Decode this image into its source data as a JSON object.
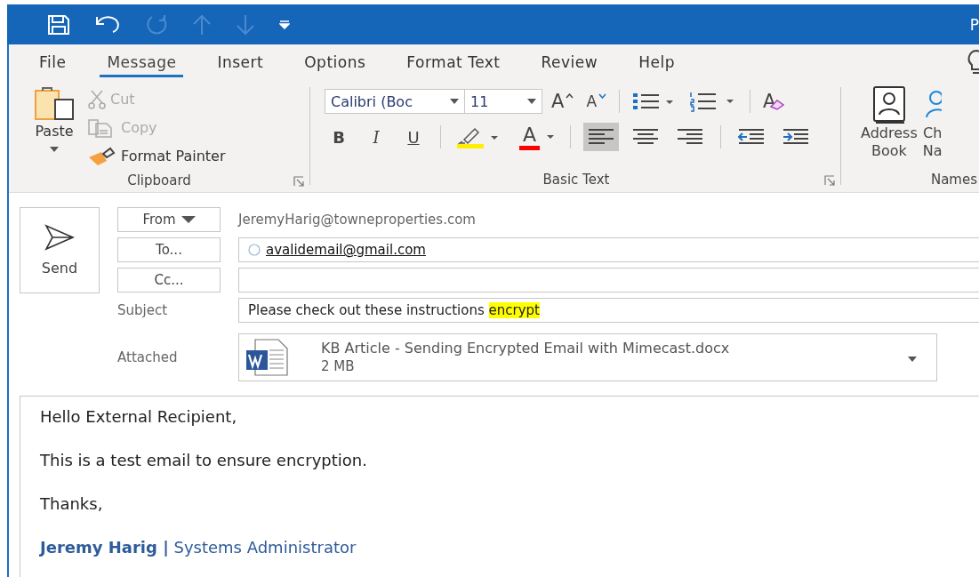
{
  "title_bar": {
    "title": "P",
    "quick_access": [
      {
        "kind": "save",
        "disabled": false
      },
      {
        "kind": "undo",
        "disabled": false
      },
      {
        "kind": "redo",
        "disabled": true
      },
      {
        "kind": "up",
        "disabled": true
      },
      {
        "kind": "down",
        "disabled": true
      },
      {
        "kind": "customize",
        "disabled": false
      }
    ]
  },
  "tabs": [
    {
      "label": "File",
      "selected": false
    },
    {
      "label": "Message",
      "selected": true
    },
    {
      "label": "Insert",
      "selected": false
    },
    {
      "label": "Options",
      "selected": false
    },
    {
      "label": "Format Text",
      "selected": false
    },
    {
      "label": "Review",
      "selected": false
    },
    {
      "label": "Help",
      "selected": false
    }
  ],
  "clipboard": {
    "paste": "Paste",
    "group": "Clipboard",
    "items": [
      {
        "kind": "cut",
        "label": "Cut",
        "disabled": true
      },
      {
        "kind": "copy",
        "label": "Copy",
        "disabled": true
      },
      {
        "kind": "painter",
        "label": "Format Painter",
        "disabled": false
      }
    ]
  },
  "basic_text": {
    "group": "Basic Text",
    "font": "Calibri (Boc",
    "size": "11",
    "row1": [
      {
        "kind": "grow",
        "glyph": "A"
      },
      {
        "kind": "shrink",
        "glyph": "A"
      },
      {
        "kind": "bullets"
      },
      {
        "kind": "numbering"
      },
      {
        "kind": "clear",
        "glyph": "A"
      }
    ],
    "row2": [
      {
        "kind": "bold",
        "glyph": "B"
      },
      {
        "kind": "italic",
        "glyph": "I"
      },
      {
        "kind": "underline",
        "glyph": "U"
      },
      {
        "kind": "highlight"
      },
      {
        "kind": "font_color",
        "glyph": "A"
      }
    ],
    "alignment": [
      {
        "kind": "left",
        "selected": true
      },
      {
        "kind": "center",
        "selected": false
      },
      {
        "kind": "right",
        "selected": false
      }
    ],
    "indent": [
      {
        "kind": "outdent"
      },
      {
        "kind": "indent"
      }
    ]
  },
  "names": {
    "group": "Names",
    "items": [
      {
        "kind": "address_book",
        "lines": [
          "Address",
          "Book"
        ]
      },
      {
        "kind": "check_names",
        "lines": [
          "Ch",
          "Na"
        ]
      }
    ]
  },
  "compose": {
    "send": "Send",
    "from_button": "From",
    "from": "JeremyHarig@towneproperties.com",
    "to_button": "To...",
    "to": [
      "avalidemail@gmail.com"
    ],
    "cc_button": "Cc...",
    "subject_label": "Subject",
    "subject": "Please check out these instructions",
    "subject_highlight": "encrypt",
    "attached_label": "Attached",
    "attachment": {
      "name": "KB Article - Sending Encrypted Email with Mimecast.docx",
      "size": "2 MB"
    }
  },
  "body": {
    "paragraphs": [
      "Hello External Recipient,",
      "This is a test email to ensure encryption.",
      "Thanks,"
    ],
    "signature": "**Jeremy Harig |** Systems Administrator"
  }
}
